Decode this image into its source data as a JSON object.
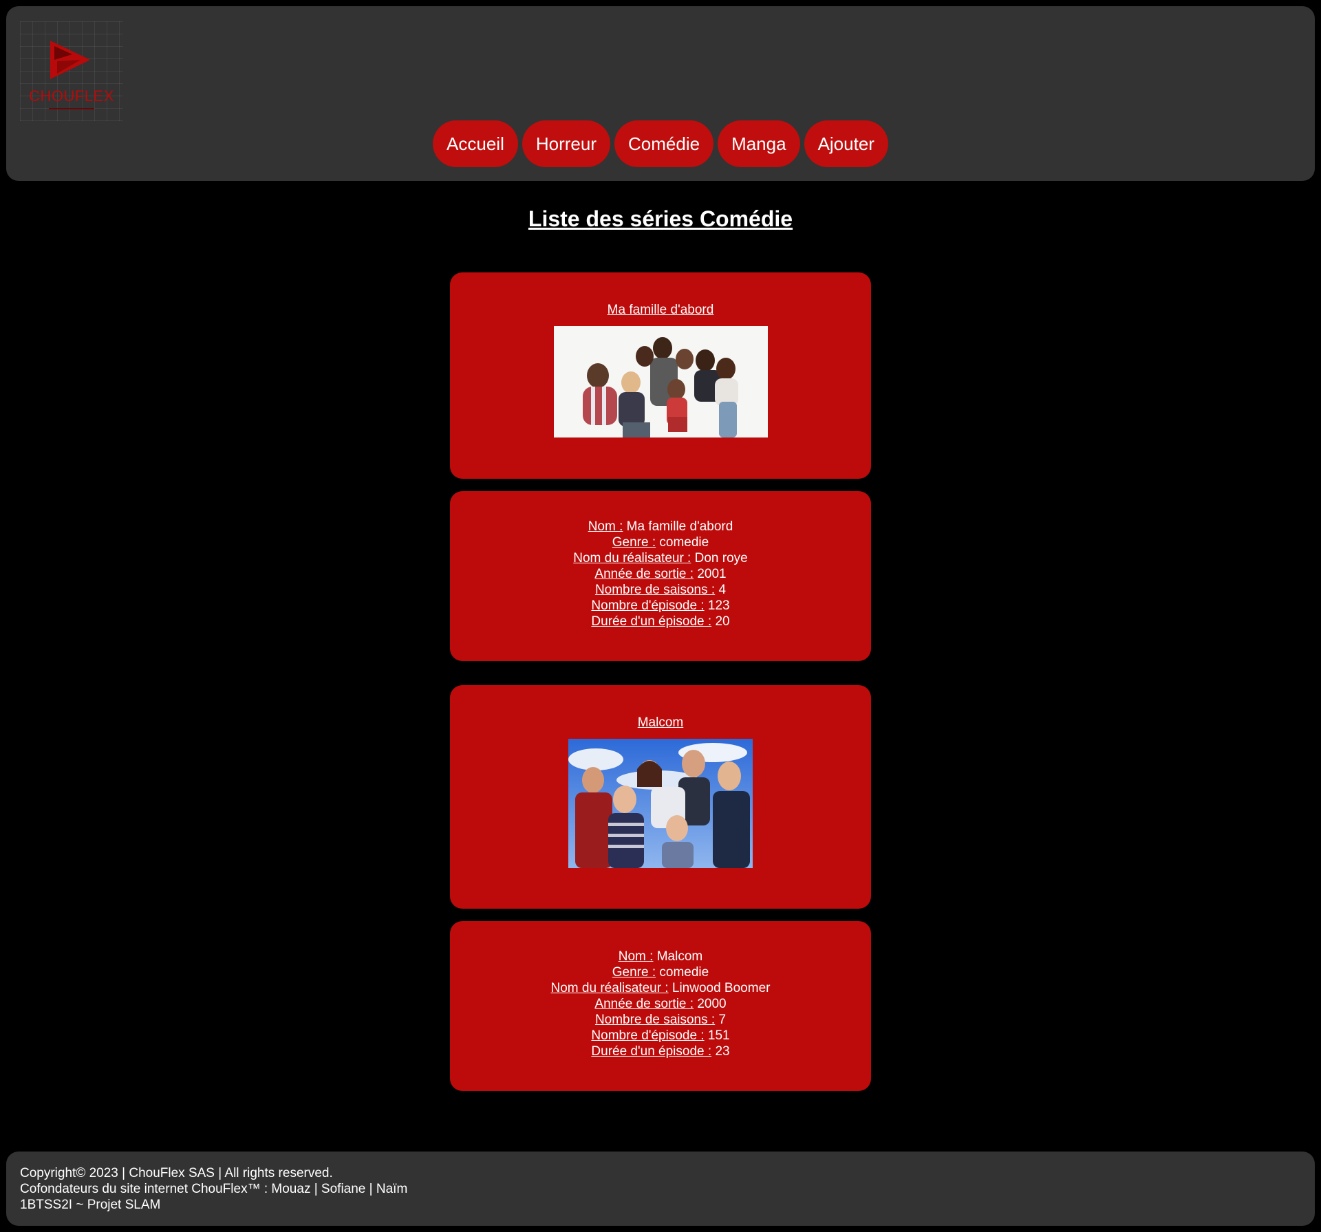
{
  "brand": {
    "logo_text": "CHOUFLEX",
    "accent": "#bd0b0b",
    "header_bg": "#333333",
    "page_bg": "#000000"
  },
  "nav": {
    "items": [
      {
        "label": "Accueil"
      },
      {
        "label": "Horreur"
      },
      {
        "label": "Comédie"
      },
      {
        "label": "Manga"
      },
      {
        "label": "Ajouter"
      }
    ]
  },
  "page_title": "Liste des séries Comédie",
  "series": [
    {
      "title": "Ma famille d'abord",
      "poster_icon": "family-photo",
      "fields": [
        {
          "label": "Nom :",
          "value": "Ma famille d'abord"
        },
        {
          "label": "Genre :",
          "value": "comedie"
        },
        {
          "label": "Nom du réalisateur :",
          "value": "Don roye"
        },
        {
          "label": "Année de sortie :",
          "value": "2001"
        },
        {
          "label": "Nombre de saisons :",
          "value": "4"
        },
        {
          "label": "Nombre d'épisode :",
          "value": "123"
        },
        {
          "label": "Durée d'un épisode :",
          "value": "20"
        }
      ]
    },
    {
      "title": "Malcom",
      "poster_icon": "family-sky-photo",
      "fields": [
        {
          "label": "Nom :",
          "value": "Malcom"
        },
        {
          "label": "Genre :",
          "value": "comedie"
        },
        {
          "label": "Nom du réalisateur :",
          "value": "Linwood Boomer"
        },
        {
          "label": "Année de sortie :",
          "value": "2000"
        },
        {
          "label": "Nombre de saisons :",
          "value": "7"
        },
        {
          "label": "Nombre d'épisode :",
          "value": "151"
        },
        {
          "label": "Durée d'un épisode :",
          "value": "23"
        }
      ]
    }
  ],
  "footer": {
    "line1": "Copyright© 2023 | ChouFlex SAS | All rights reserved.",
    "line2": "Cofondateurs du site internet ChouFlex™ : Mouaz | Sofiane | Naïm",
    "line3": "1BTSS2I ~ Projet SLAM"
  }
}
